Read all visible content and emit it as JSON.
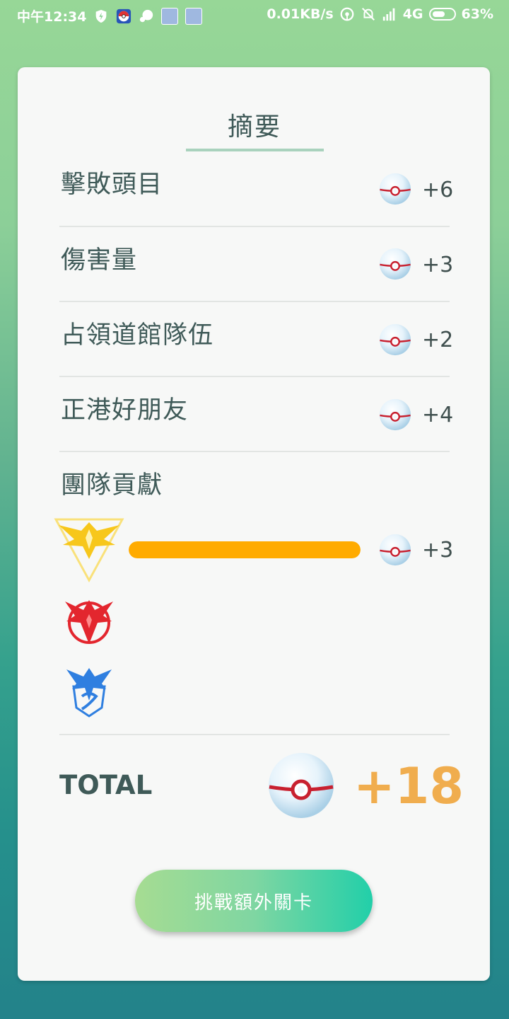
{
  "status_bar": {
    "time": "中午12:34",
    "network_speed": "0.01KB/s",
    "network_type": "4G",
    "battery": "63%",
    "battery_level": 0.63,
    "icons": [
      "shield-icon",
      "pokeball-icon",
      "chat-bubble-icon",
      "app-thumbnail-icon",
      "app-thumbnail-icon",
      "hotspot-icon",
      "mute-icon",
      "signal-icon",
      "battery-icon"
    ]
  },
  "summary": {
    "title": "摘要",
    "rows": [
      {
        "label": "擊敗頭目",
        "value": "+6"
      },
      {
        "label": "傷害量",
        "value": "+3"
      },
      {
        "label": "占領道館隊伍",
        "value": "+2"
      },
      {
        "label": "正港好朋友",
        "value": "+4"
      }
    ],
    "team_section": {
      "label": "團隊貢獻",
      "teams": [
        {
          "name_icon": "instinct-team-icon",
          "color": "#ffab00",
          "progress": 1.0,
          "value": "+3"
        },
        {
          "name_icon": "valor-team-icon",
          "color": "#e3262e"
        },
        {
          "name_icon": "mystic-team-icon",
          "color": "#2f7fe0"
        }
      ]
    },
    "total": {
      "label": "TOTAL",
      "value": "+18"
    },
    "button_label": "挑戰額外關卡"
  },
  "colors": {
    "accent_orange": "#f0ad4e",
    "title_underline": "#a9d2bd",
    "button_gradient": [
      "#a6dc92",
      "#22cfa9"
    ]
  }
}
